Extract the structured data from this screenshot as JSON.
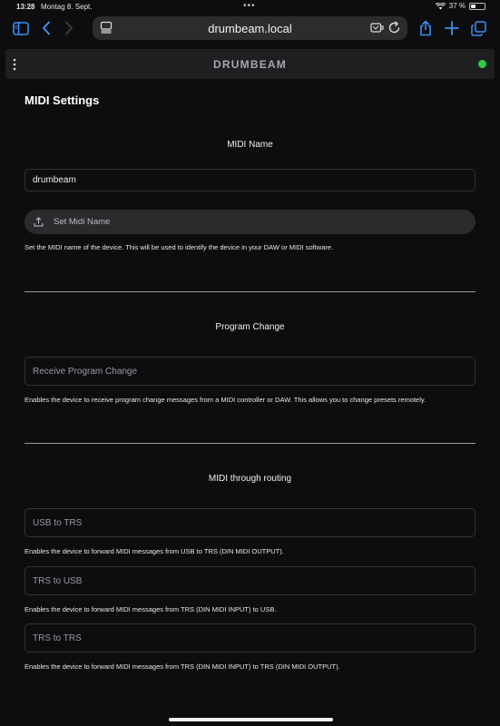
{
  "status": {
    "time": "13:28",
    "date": "Montag 8. Sept.",
    "battery_text": "37 %",
    "battery_level": 0.37
  },
  "browser": {
    "url": "drumbeam.local",
    "icons": [
      "sidebar-icon",
      "back-icon",
      "forward-icon",
      "page-menu-icon",
      "reader-icon",
      "reload-icon",
      "share-icon",
      "new-tab-icon",
      "tabs-icon"
    ]
  },
  "app": {
    "title": "DRUMBEAM",
    "connection_color": "#2ecc40"
  },
  "page": {
    "title": "MIDI Settings"
  },
  "midi_name": {
    "heading": "MIDI Name",
    "value": "drumbeam",
    "button_label": "Set Midi Name",
    "help": "Set the MIDI name of the device. This will be used to identify the device in your DAW or MIDI software."
  },
  "program_change": {
    "heading": "Program Change",
    "toggle_label": "Receive Program Change",
    "help": "Enables the device to receive program change messages from a MIDI controller or DAW. This allows you to change presets remotely."
  },
  "routing": {
    "heading": "MIDI through routing",
    "items": [
      {
        "label": "USB to TRS",
        "help": "Enables the device to forward MIDI messages from USB to TRS (DIN MIDI OUTPUT)."
      },
      {
        "label": "TRS to USB",
        "help": "Enables the device to forward MIDI messages from TRS (DIN MIDI INPUT) to USB."
      },
      {
        "label": "TRS to TRS",
        "help": "Enables the device to forward MIDI messages from TRS (DIN MIDI INPUT) to TRS (DIN MIDI OUTPUT)."
      }
    ]
  },
  "colors": {
    "background": "#0d0d0f",
    "accent": "#3d8ef7"
  }
}
